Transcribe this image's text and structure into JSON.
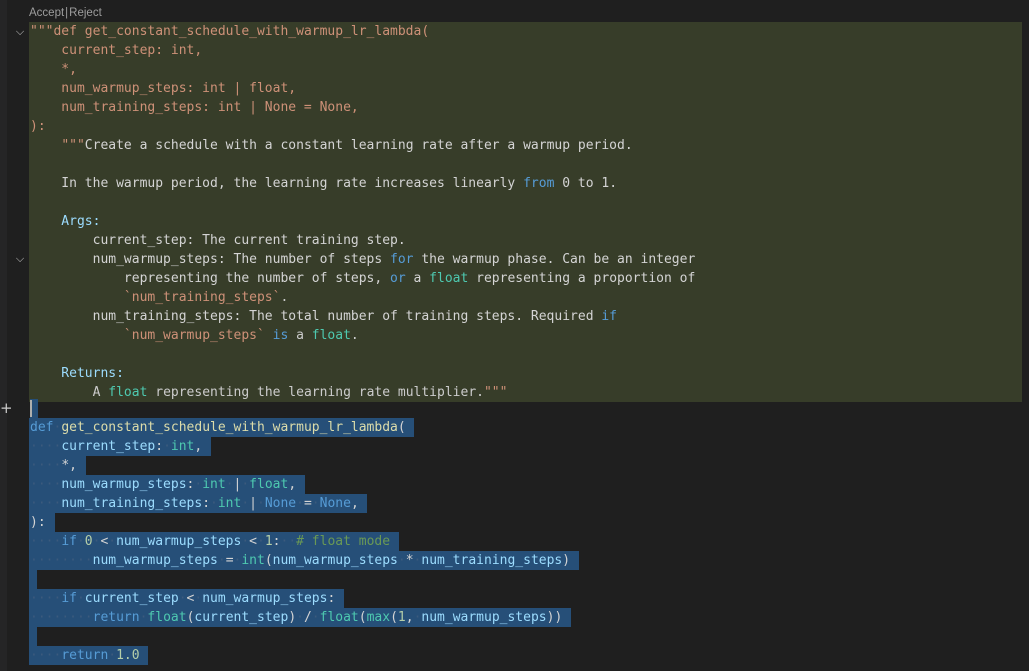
{
  "codelens": {
    "accept": "Accept",
    "separator": "|",
    "reject": "Reject"
  },
  "inserted_lines": [
    "\"\"\"def get_constant_schedule_with_warmup_lr_lambda(",
    "    current_step: int,",
    "    *,",
    "    num_warmup_steps: int | float,",
    "    num_training_steps: int | None = None,",
    "):",
    "    \"\"\"Create a schedule with a constant learning rate after a warmup period.",
    "",
    "    In the warmup period, the learning rate increases linearly from 0 to 1.",
    "",
    "    Args:",
    "        current_step: The current training step.",
    "        num_warmup_steps: The number of steps for the warmup phase. Can be an integer",
    "            representing the number of steps, or a float representing a proportion of",
    "            `num_training_steps`.",
    "        num_training_steps: The total number of training steps. Required if",
    "            `num_warmup_steps` is a float.",
    "",
    "    Returns:",
    "        A float representing the learning rate multiplier.\"\"\""
  ],
  "selected_lines": [
    "",
    "def get_constant_schedule_with_warmup_lr_lambda(",
    "    current_step: int,",
    "    *,",
    "    num_warmup_steps: int | float,",
    "    num_training_steps: int | None = None,",
    "):",
    "    if 0 < num_warmup_steps < 1:  # float mode",
    "        num_warmup_steps = int(num_warmup_steps * num_training_steps)",
    "",
    "    if current_step < num_warmup_steps:",
    "        return float(current_step) / float(max(1, num_warmup_steps))",
    "",
    "    return 1.0"
  ],
  "icons": {
    "fold": "chevron-down-icon",
    "add": "plus-icon"
  },
  "colors": {
    "background": "#1f1f1f",
    "inserted_bg": "#373d29",
    "selection": "#264f78",
    "keyword": "#569cd6",
    "function": "#dcdcaa",
    "param": "#9cdcfe",
    "type": "#4ec9b0",
    "string": "#ce9178",
    "comment": "#6a9955"
  }
}
